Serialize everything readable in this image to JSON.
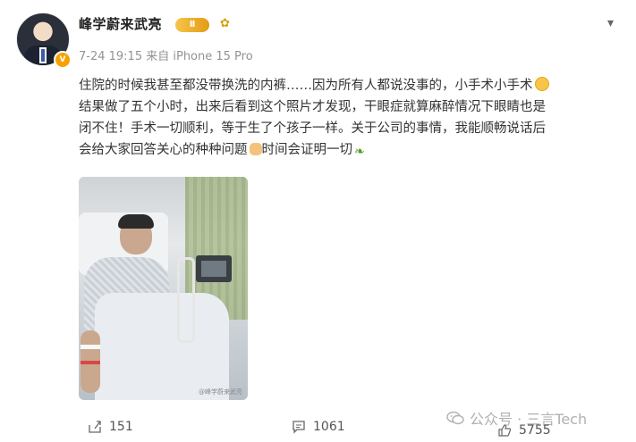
{
  "author": {
    "name": "峰学蔚来武亮",
    "level_badge": "Ⅱ",
    "meta": "7-24 19:15 来自 iPhone 15 Pro"
  },
  "post": {
    "line1": "住院的时候我甚至都没带换洗的内裤……因为所有人都说没事的，小手术小手术",
    "line2": "结果做了五个小时，出来后看到这个照片才发现，干眼症就算麻醉情况下眼睛也是",
    "line3": "闭不住！手术一切顺利，等于生了个孩子一样。关于公司的事情，我能顺畅说话后",
    "line4": "会给大家回答关心的种种问题",
    "line4b": "时间会证明一切"
  },
  "photo": {
    "watermark": "@峰学蔚来武亮"
  },
  "actions": {
    "shares": "151",
    "comments": "1061",
    "likes": "5755"
  },
  "watermark": {
    "text": "公众号 · 三言Tech"
  },
  "icons": {
    "more": "chevron-down-icon",
    "share": "share-icon",
    "comment": "comment-icon",
    "like": "like-icon",
    "wechat": "wechat-icon"
  },
  "colors": {
    "meta": "#939393",
    "badge": "#f7a100",
    "name": "#222222"
  }
}
